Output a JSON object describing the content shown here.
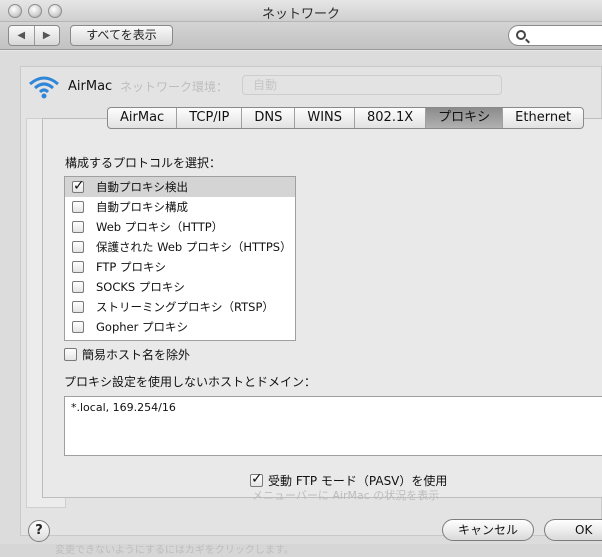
{
  "window": {
    "title": "ネットワーク"
  },
  "toolbar": {
    "back_glyph": "◀",
    "forward_glyph": "▶",
    "show_all": "すべてを表示",
    "search_placeholder": ""
  },
  "header": {
    "service_name": "AirMac",
    "ghost_label": "ネットワーク環境：",
    "ghost_value": "自動"
  },
  "tabs": [
    {
      "label": "AirMac",
      "active": false
    },
    {
      "label": "TCP/IP",
      "active": false
    },
    {
      "label": "DNS",
      "active": false
    },
    {
      "label": "WINS",
      "active": false
    },
    {
      "label": "802.1X",
      "active": false
    },
    {
      "label": "プロキシ",
      "active": true
    },
    {
      "label": "Ethernet",
      "active": false
    }
  ],
  "proxy": {
    "section_label": "構成するプロトコルを選択：",
    "protocols": [
      {
        "label": "自動プロキシ検出",
        "checked": true,
        "selected": true
      },
      {
        "label": "自動プロキシ構成",
        "checked": false,
        "selected": false
      },
      {
        "label": "Web プロキシ（HTTP）",
        "checked": false,
        "selected": false
      },
      {
        "label": "保護された Web プロキシ（HTTPS）",
        "checked": false,
        "selected": false
      },
      {
        "label": "FTP プロキシ",
        "checked": false,
        "selected": false
      },
      {
        "label": "SOCKS プロキシ",
        "checked": false,
        "selected": false
      },
      {
        "label": "ストリーミングプロキシ（RTSP）",
        "checked": false,
        "selected": false
      },
      {
        "label": "Gopher プロキシ",
        "checked": false,
        "selected": false
      }
    ],
    "exclude_simple_hostnames": {
      "label": "簡易ホスト名を除外",
      "checked": false
    },
    "bypass_label": "プロキシ設定を使用しないホストとドメイン：",
    "bypass_value": "*.local, 169.254/16",
    "pasv": {
      "label": "受動 FTP モード（PASV）を使用",
      "checked": true
    }
  },
  "background": {
    "menu_hint": "メニューバーに AirMac の状況を表示",
    "lock_hint": "変更できないようにするにはカギをクリックします。"
  },
  "footer": {
    "help": "?",
    "cancel": "キャンセル",
    "ok": "OK"
  }
}
